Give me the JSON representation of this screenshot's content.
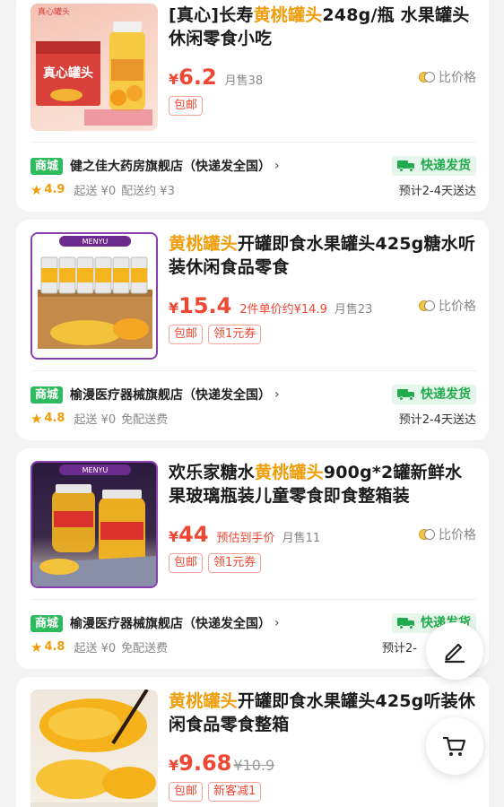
{
  "products": [
    {
      "title_pre": "[真心]长寿",
      "title_hl": "黄桃罐头",
      "title_post": "248g/瓶 水果罐头休闲零食小吃",
      "yen": "¥",
      "price": "6.2",
      "unit_price": "",
      "sold": "月售38",
      "original_price": "",
      "compare_label": "比价格",
      "tags": [
        "包邮"
      ],
      "store_badge": "商城",
      "store_name": "健之佳大药房旗舰店（快递发全国）",
      "ship_label": "快递发货",
      "rating": "4.9",
      "min_order": "起送 ¥0",
      "delivery_fee": "配送约 ¥3",
      "eta": "预计2-4天送达",
      "thumb_text": "真心罐头"
    },
    {
      "title_pre": "",
      "title_hl": "黄桃罐头",
      "title_post": "开罐即食水果罐头425g糖水听装休闲食品零食",
      "yen": "¥",
      "price": "15.4",
      "unit_price": "2件单价约¥14.9",
      "sold": "月售23",
      "original_price": "",
      "compare_label": "比价格",
      "tags": [
        "包邮",
        "领1元券"
      ],
      "store_badge": "商城",
      "store_name": "榆漫医疗器械旗舰店（快递发全国）",
      "ship_label": "快递发货",
      "rating": "4.8",
      "min_order": "起送 ¥0",
      "delivery_fee": "免配送费",
      "eta": "预计2-4天送达",
      "thumb_text": "MENYU"
    },
    {
      "title_pre": "欢乐家糖水",
      "title_hl": "黄桃罐头",
      "title_post": "900g*2罐新鲜水果玻璃瓶装儿童零食即食整箱装",
      "yen": "¥",
      "price": "44",
      "unit_price": "预估到手价",
      "sold": "月售11",
      "original_price": "",
      "compare_label": "比价格",
      "tags": [
        "包邮",
        "领1元券"
      ],
      "store_badge": "商城",
      "store_name": "榆漫医疗器械旗舰店（快递发全国）",
      "ship_label": "快递发货",
      "rating": "4.8",
      "min_order": "起送 ¥0",
      "delivery_fee": "免配送费",
      "eta": "预计2-",
      "thumb_text": "MENYU"
    },
    {
      "title_pre": "",
      "title_hl": "黄桃罐头",
      "title_post": "开罐即食水果罐头425g听装休闲食品零食整箱",
      "yen": "¥",
      "price": "9.68",
      "unit_price": "",
      "sold": "",
      "original_price": "¥10.9",
      "compare_label": "",
      "tags": [
        "包邮",
        "新客减1"
      ],
      "thumb_text": ""
    }
  ],
  "fab": {
    "edit_icon": "pencil-icon",
    "cart_icon": "cart-icon"
  },
  "colors": {
    "accent": "#ef9d0a",
    "price": "#ee4733",
    "mall": "#2dbb5d",
    "ship": "#1faa4d"
  }
}
